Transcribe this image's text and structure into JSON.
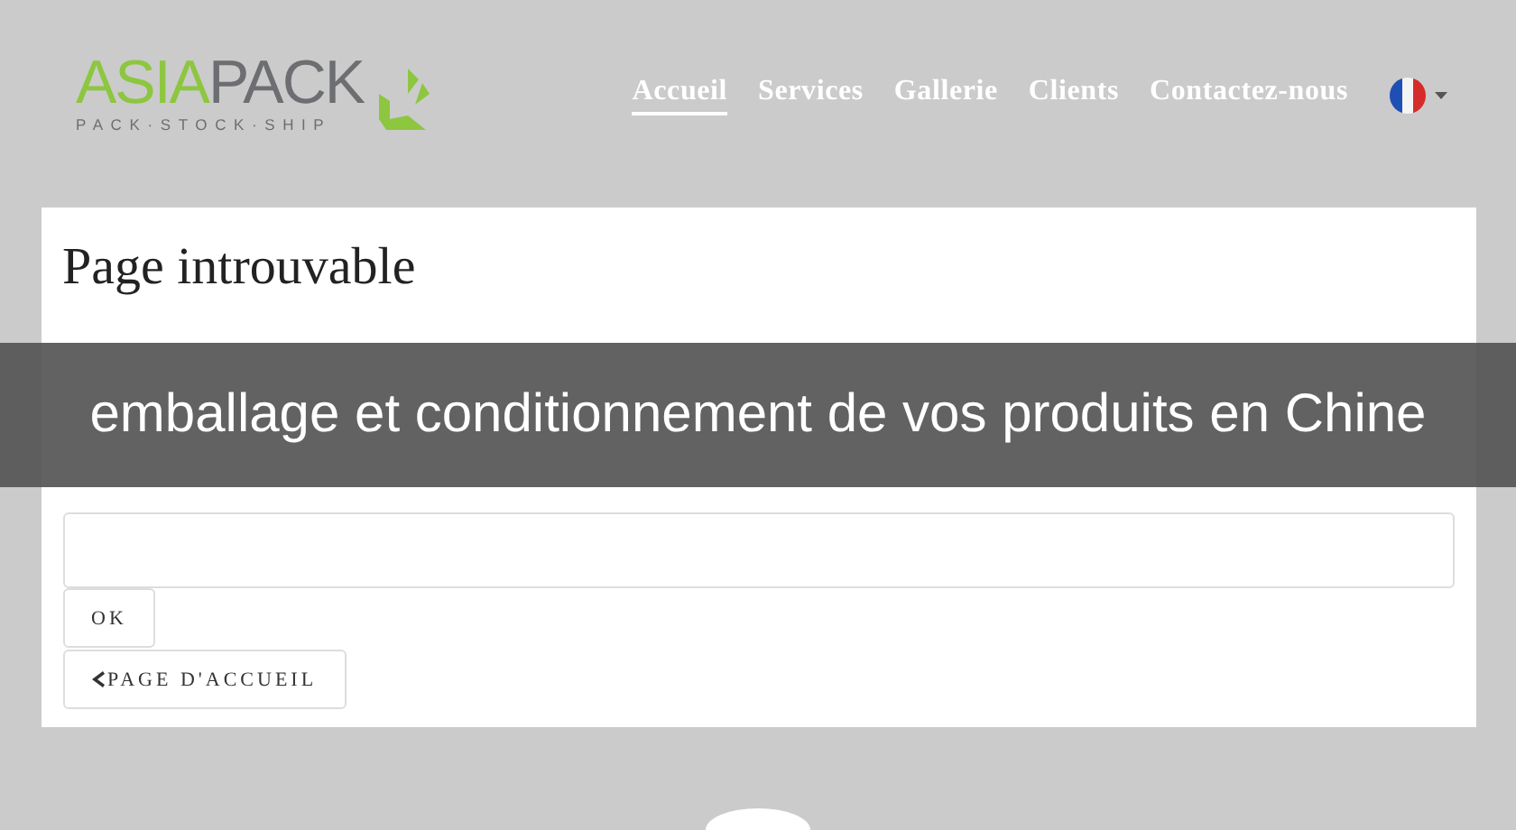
{
  "header": {
    "logo": {
      "part_1": "ASIA",
      "part_2": "PACK",
      "tagline": "PACK·STOCK·SHIP"
    },
    "nav": [
      {
        "label": "Accueil",
        "selected": true
      },
      {
        "label": "Services",
        "selected": false
      },
      {
        "label": "Gallerie",
        "selected": false
      },
      {
        "label": "Clients",
        "selected": false
      },
      {
        "label": "Contactez-nous",
        "selected": false
      }
    ]
  },
  "card": {
    "title": "Page introuvable",
    "buttons": [
      {
        "label": "OK",
        "kind": "submit"
      },
      {
        "label": "PAGE D'ACCUEIL",
        "kind": "back"
      }
    ]
  },
  "caption": "emballage et conditionnement de vos produits en Chine"
}
